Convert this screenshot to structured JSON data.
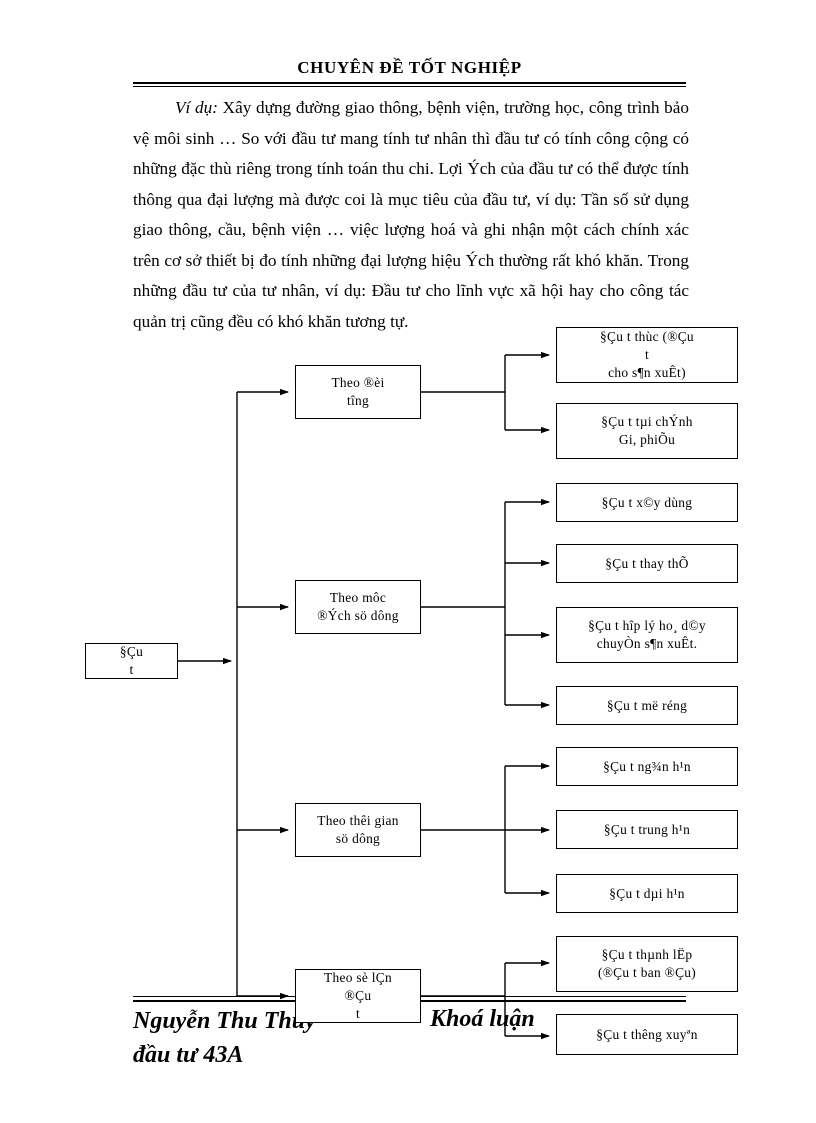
{
  "header": {
    "title": "CHUYÊN ĐỀ TỐT NGHIỆP"
  },
  "body": {
    "lead": "Ví dụ:",
    "paragraph": " Xây dựng đường giao thông, bệnh viện, trường học, công trình bảo vệ môi sinh … So với đầu tư mang tính tư nhân thì đầu tư có tính công cộng có những đặc thù riêng trong tính toán thu chi. Lợi Ých của đầu tư có thể được tính thông qua đại lượng mà được coi là mục tiêu của đầu tư, ví dụ: Tần số sử dụng giao thông, cầu, bệnh viện … việc lượng hoá và ghi nhận một cách chính xác trên cơ sở thiết bị đo tính những đại lượng hiệu Ých thường rất khó khăn. Trong những đầu tư của tư nhân, ví dụ: Đầu tư cho lĩnh vực xã hội hay cho công tác quản trị cũng đều có khó khăn tương tự."
  },
  "diagram": {
    "root": {
      "label": "§Çu t­"
    },
    "branches": [
      {
        "label_line1": "Theo ®èi",
        "label_line2": "t­îng"
      },
      {
        "label_line1": "Theo môc",
        "label_line2": "®Ých sö dông"
      },
      {
        "label_line1": "Theo thêi gian",
        "label_line2": "sö dông"
      },
      {
        "label_line1": "Theo sè lÇn",
        "label_line2": "®Çu t­"
      }
    ],
    "leaves": [
      {
        "line1": "§Çu t­ thùc (®Çu t­",
        "line2": "cho s¶n xuÊt)"
      },
      {
        "line1": "§Çu t­ tµi chÝnh",
        "line2": "Gi, phiÕu"
      },
      {
        "line1": "§Çu t­ x©y dùng",
        "line2": ""
      },
      {
        "line1": "§Çu t­ thay thÕ",
        "line2": ""
      },
      {
        "line1": "§Çu t­ hîp lý ho¸ d©y",
        "line2": "chuyÒn s¶n xuÊt."
      },
      {
        "line1": "§Çu t­ më réng",
        "line2": ""
      },
      {
        "line1": "§Çu t­ ng¾n h¹n",
        "line2": ""
      },
      {
        "line1": "§Çu t­ trung h¹n",
        "line2": ""
      },
      {
        "line1": "§Çu t­ dµi h¹n",
        "line2": ""
      },
      {
        "line1": "§Çu t­ thµnh lËp",
        "line2": "(®Çu t­ ban ®Çu)"
      },
      {
        "line1": "§Çu t­ th­êng xuyªn",
        "line2": ""
      }
    ]
  },
  "footer": {
    "name": "Nguyễn Thu Thuỷ",
    "class": "đầu tư 43A",
    "hidden_right": "Khoá luận"
  },
  "colors": {
    "text": "#000000",
    "page": "#ffffff",
    "rule": "#000000"
  }
}
